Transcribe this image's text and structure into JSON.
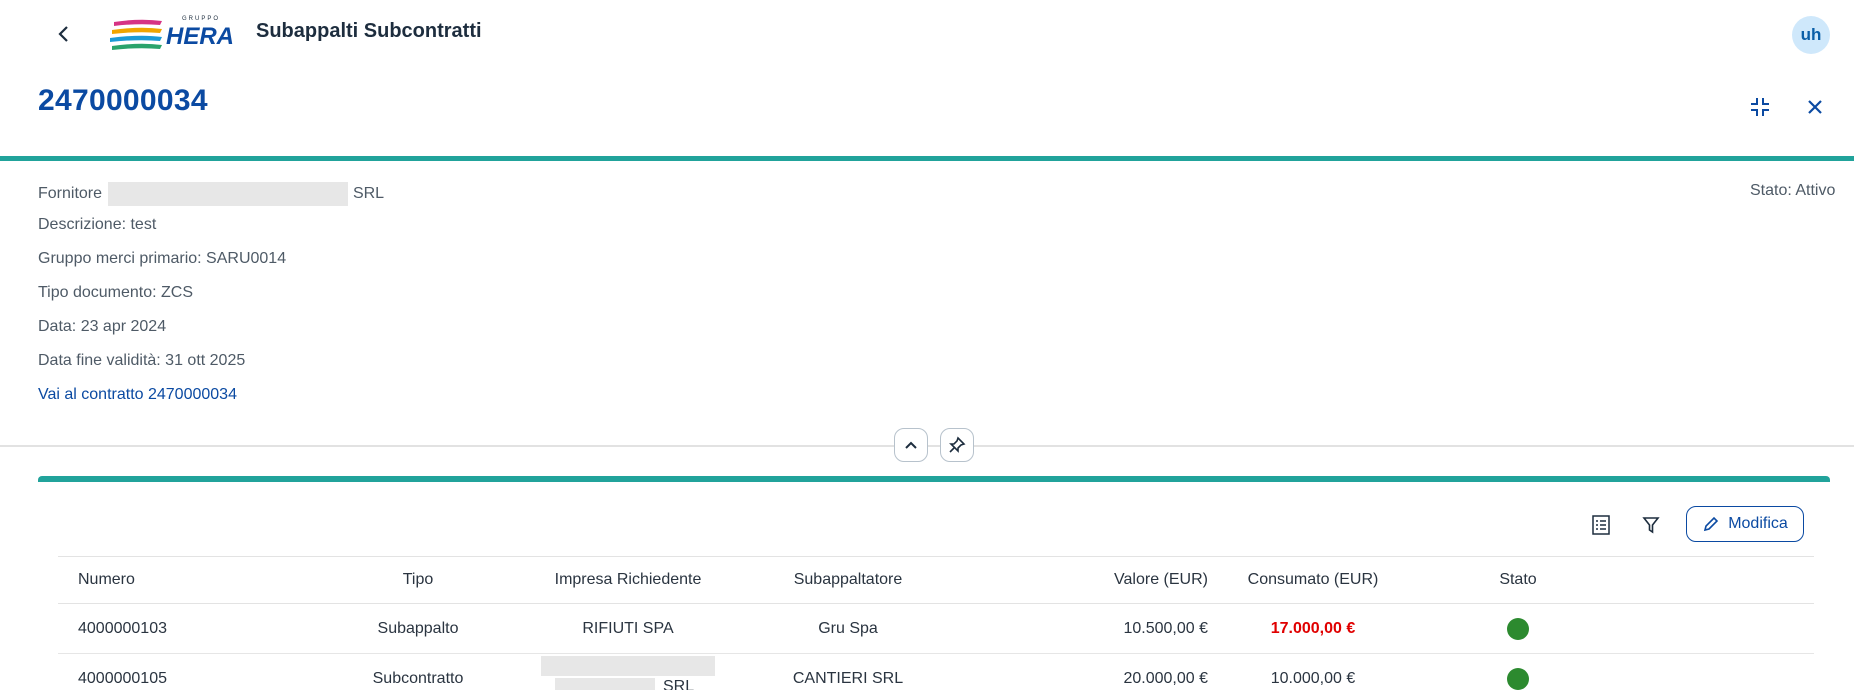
{
  "shell": {
    "app_title": "Subappalti Subcontratti",
    "avatar_initials": "uh",
    "logo_text": "HERA",
    "logo_small_text": "GRUPPO"
  },
  "object": {
    "title": "2470000034",
    "fornitore_label": "Fornitore",
    "fornitore_suffix": "SRL",
    "descrizione": "Descrizione: test",
    "gruppo_merci": "Gruppo merci primario: SARU0014",
    "tipo_documento": "Tipo documento: ZCS",
    "data": "Data: 23 apr 2024",
    "data_fine": "Data fine validità: 31 ott 2025",
    "link": "Vai al contratto 2470000034",
    "stato": "Stato: Attivo"
  },
  "toolbar": {
    "modifica_label": "Modifica"
  },
  "table": {
    "headers": {
      "numero": "Numero",
      "tipo": "Tipo",
      "impresa": "Impresa Richiedente",
      "subappaltatore": "Subappaltatore",
      "valore": "Valore (EUR)",
      "consumato": "Consumato (EUR)",
      "stato": "Stato"
    },
    "rows": [
      {
        "numero": "4000000103",
        "tipo": "Subappalto",
        "impresa": "RIFIUTI SPA",
        "subappaltatore": "Gru Spa",
        "valore": "10.500,00 €",
        "consumato": "17.000,00 €",
        "stato_color": "#2c8a2f"
      },
      {
        "numero": "4000000105",
        "tipo": "Subcontratto",
        "impresa": "SRL",
        "subappaltatore": "CANTIERI SRL",
        "valore": "20.000,00 €",
        "consumato": "10.000,00 €",
        "stato_color": "#2c8a2f"
      }
    ]
  },
  "colors": {
    "accent": "#21a39b",
    "brand_blue": "#0b4aa2",
    "overrun_red": "#e00000",
    "status_green": "#2c8a2f"
  }
}
